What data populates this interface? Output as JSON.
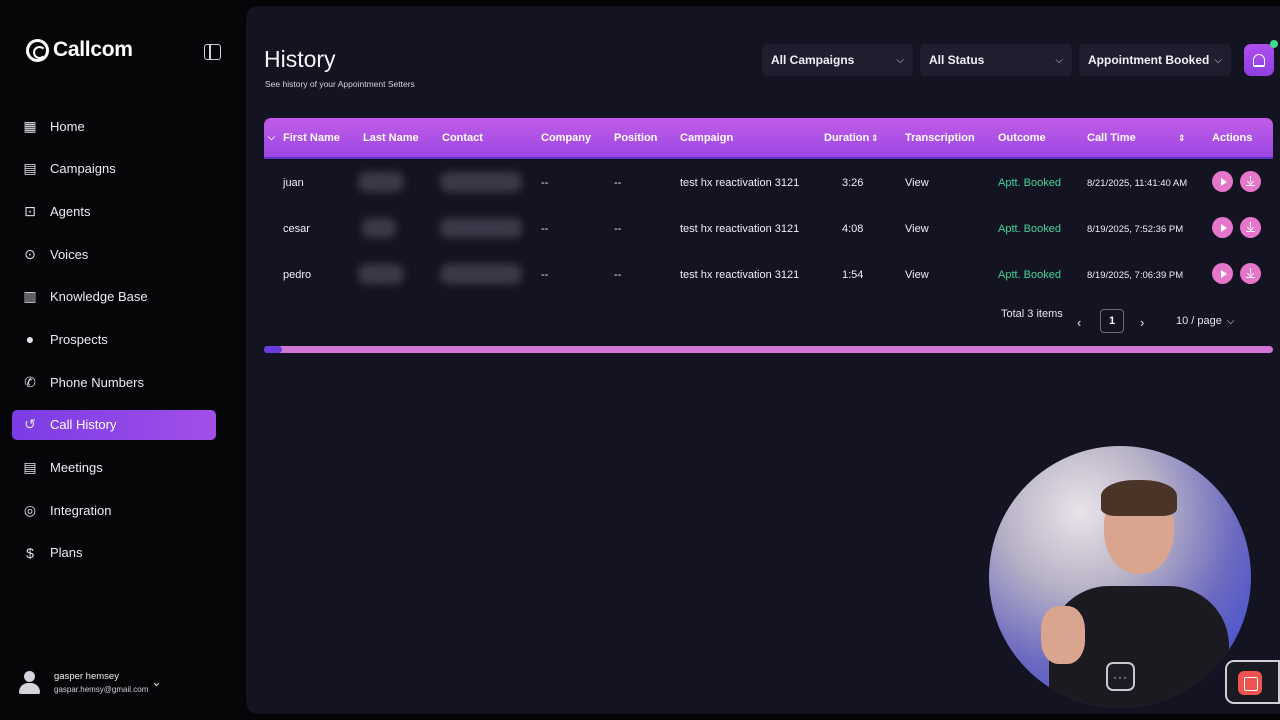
{
  "app": {
    "name": "Callcom"
  },
  "sidebar": {
    "items": [
      {
        "label": "Home",
        "icon": "grid-icon"
      },
      {
        "label": "Campaigns",
        "icon": "calendar-icon"
      },
      {
        "label": "Agents",
        "icon": "robot-icon"
      },
      {
        "label": "Voices",
        "icon": "microphone-icon"
      },
      {
        "label": "Knowledge Base",
        "icon": "book-icon"
      },
      {
        "label": "Prospects",
        "icon": "user-search-icon"
      },
      {
        "label": "Phone Numbers",
        "icon": "phone-icon"
      },
      {
        "label": "Call History",
        "icon": "history-icon",
        "active": true
      },
      {
        "label": "Meetings",
        "icon": "calendar-icon"
      },
      {
        "label": "Integration",
        "icon": "target-icon"
      },
      {
        "label": "Plans",
        "icon": "dollar-icon"
      }
    ],
    "user": {
      "name": "gasper hemsey",
      "email": "gaspar.hemsy@gmail.com"
    }
  },
  "header": {
    "title": "History",
    "subtitle": "See history of your Appointment Setters",
    "filters": {
      "campaigns": "All Campaigns",
      "status": "All Status",
      "outcome": "Appointment Booked"
    }
  },
  "table": {
    "columns": {
      "first_name": "First Name",
      "last_name": "Last Name",
      "contact": "Contact",
      "company": "Company",
      "position": "Position",
      "campaign": "Campaign",
      "duration": "Duration",
      "transcription": "Transcription",
      "outcome": "Outcome",
      "call_time": "Call Time",
      "actions": "Actions"
    },
    "rows": [
      {
        "first_name": "juan",
        "company": "--",
        "position": "--",
        "campaign": "test hx reactivation 3121",
        "duration": "3:26",
        "transcription": "View",
        "outcome": "Aptt. Booked",
        "call_time": "8/21/2025, 11:41:40 AM"
      },
      {
        "first_name": "cesar",
        "company": "--",
        "position": "--",
        "campaign": "test hx reactivation 3121",
        "duration": "4:08",
        "transcription": "View",
        "outcome": "Aptt. Booked",
        "call_time": "8/19/2025, 7:52:36 PM"
      },
      {
        "first_name": "pedro",
        "company": "--",
        "position": "--",
        "campaign": "test hx reactivation 3121",
        "duration": "1:54",
        "transcription": "View",
        "outcome": "Aptt. Booked",
        "call_time": "8/19/2025, 7:06:39 PM"
      }
    ]
  },
  "pagination": {
    "total": "Total 3 items",
    "current_page": "1",
    "page_size": "10 / page"
  },
  "colors": {
    "accent": "#9b47e2",
    "outcome_green": "#43d39a",
    "action_pink": "#e676c9",
    "panel_bg": "#141321"
  }
}
